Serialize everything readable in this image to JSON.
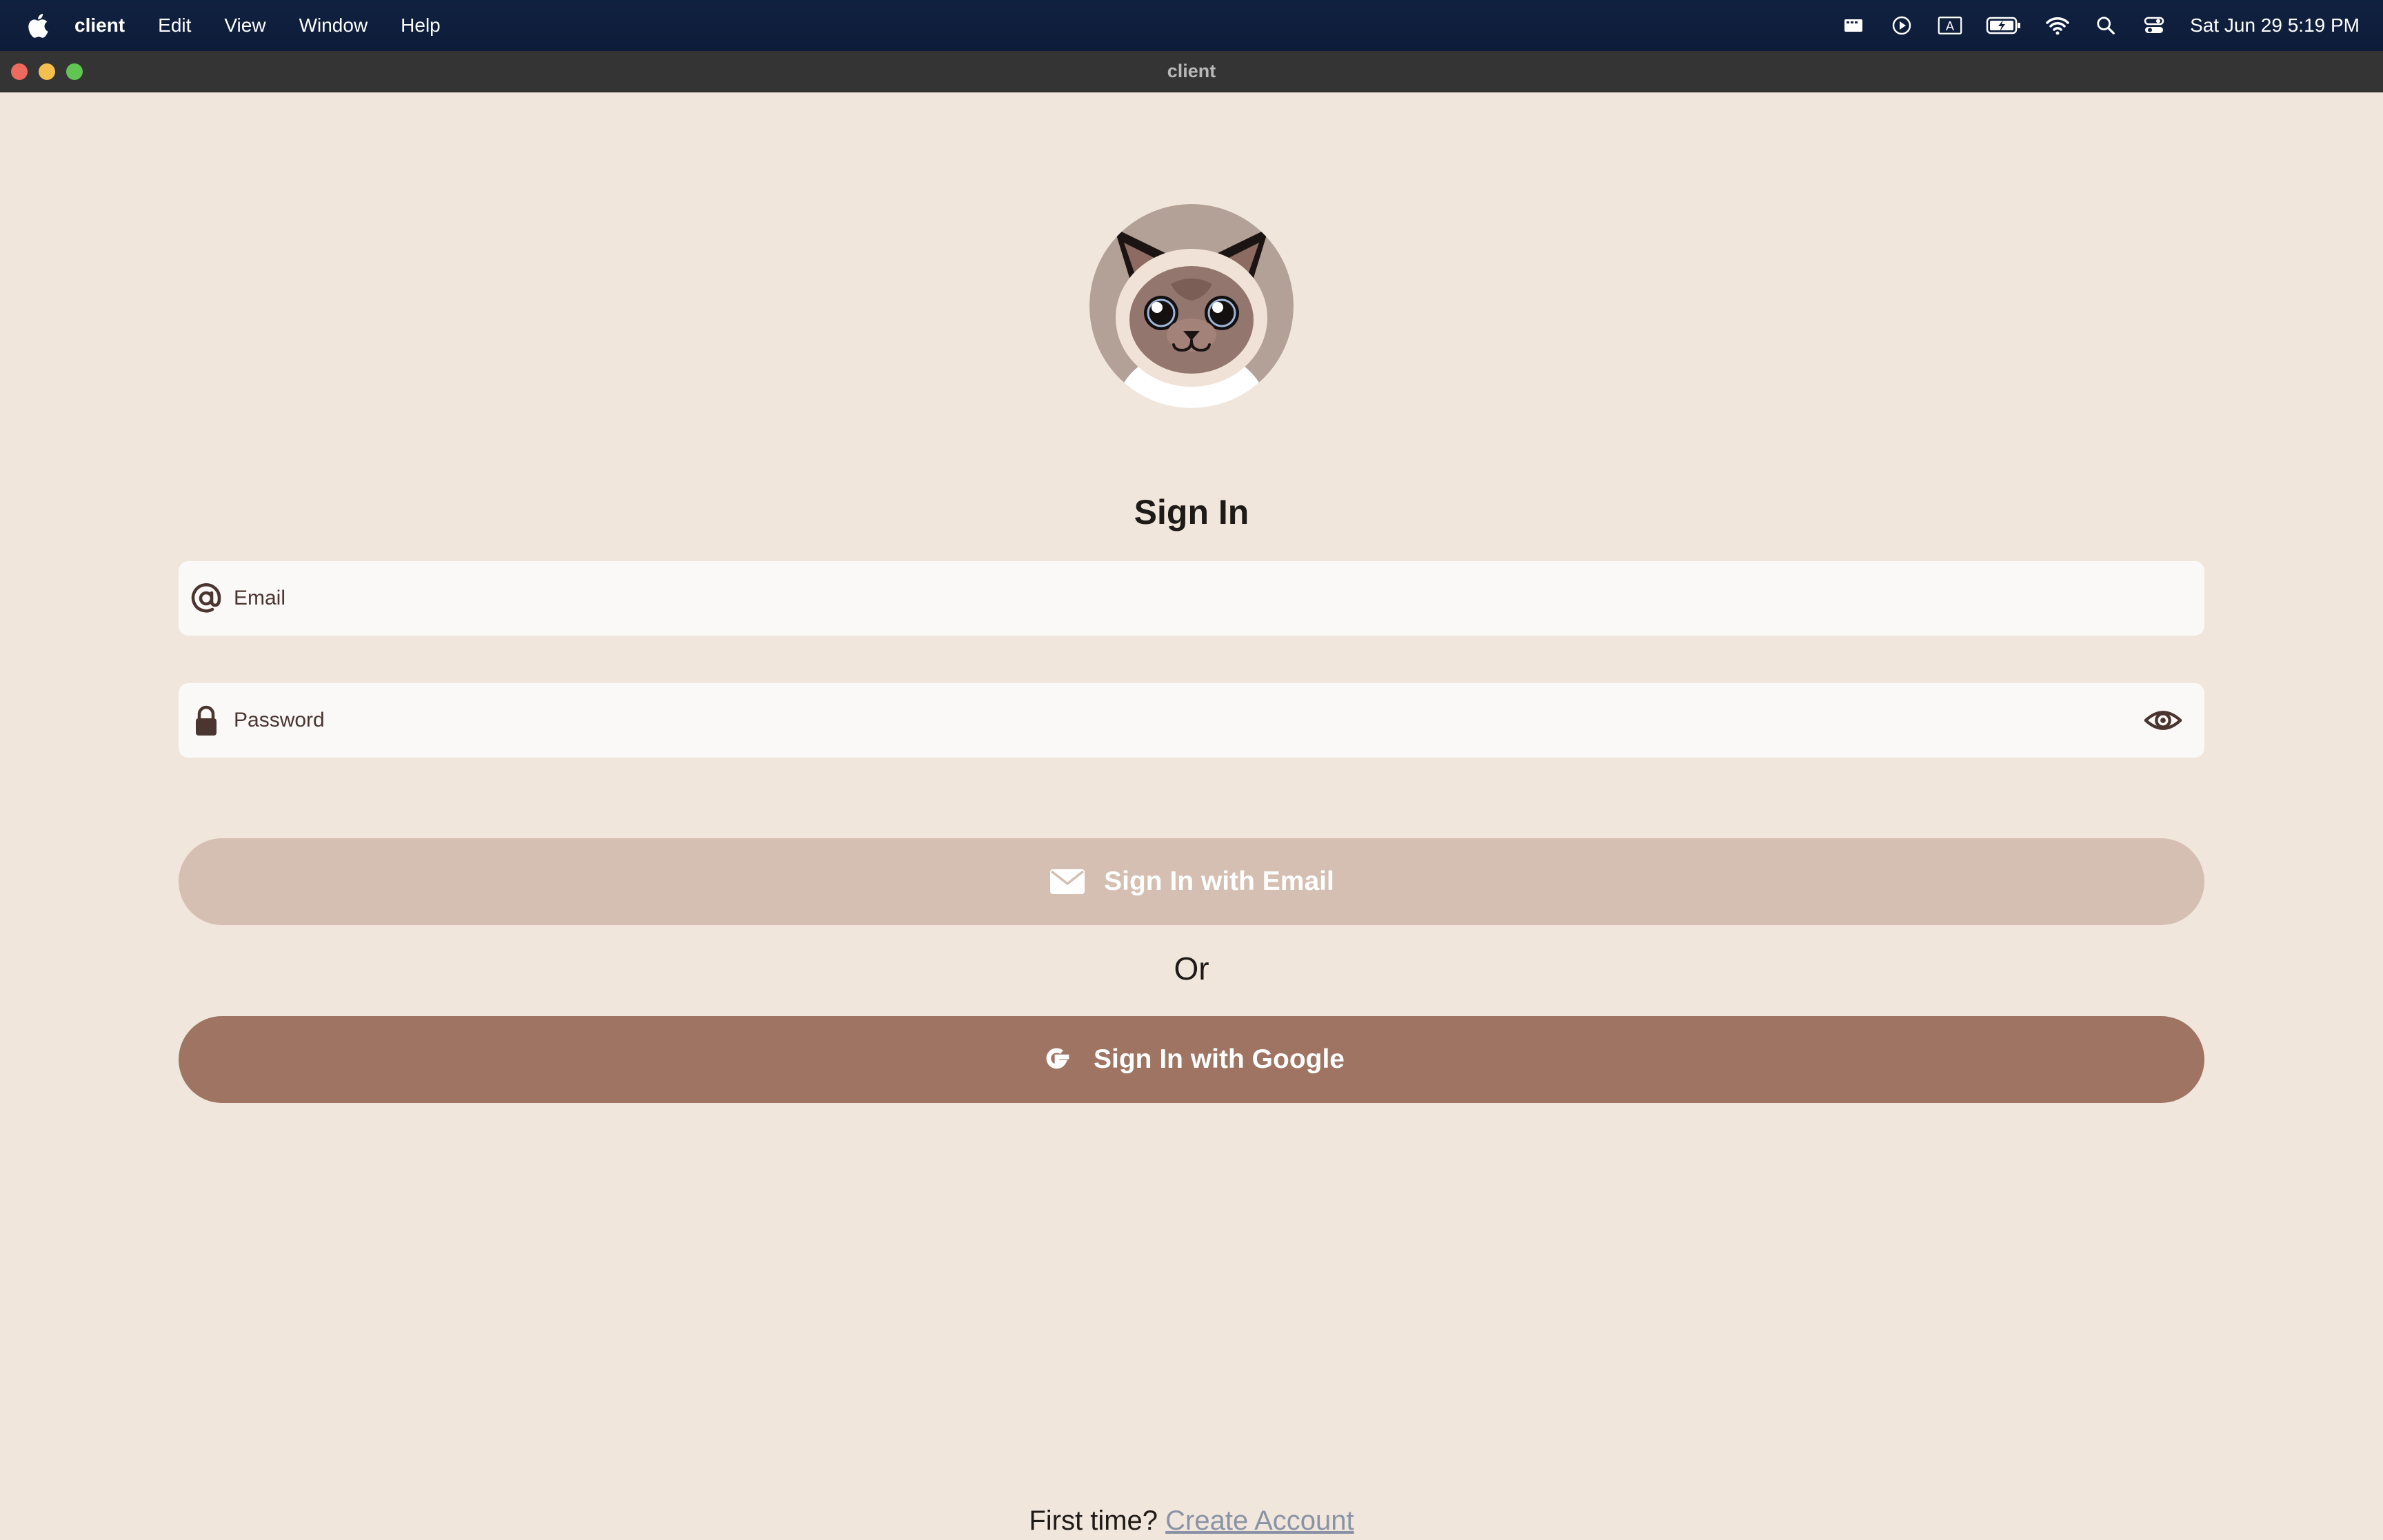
{
  "menubar": {
    "app_name": "client",
    "items": [
      "Edit",
      "View",
      "Window",
      "Help"
    ],
    "clock": "Sat Jun 29  5:19 PM",
    "status_icons": [
      "media-icon",
      "play-icon",
      "input-source-icon",
      "battery-icon",
      "wifi-icon",
      "spotlight-icon",
      "control-center-icon"
    ]
  },
  "window": {
    "title": "client"
  },
  "login": {
    "heading": "Sign In",
    "email_placeholder": "Email",
    "email_value": "",
    "password_placeholder": "Password",
    "password_value": "",
    "email_button": "Sign In with Email",
    "separator": "Or",
    "google_button": "Sign In with Google",
    "footer_prompt": "First time?",
    "footer_link": "Create Account"
  },
  "colors": {
    "background": "#f0e6db",
    "field_background": "#faf9f7",
    "email_button": "#d5bfb2",
    "google_button": "#9f7462",
    "link": "#8a93a6",
    "menubar": "#0f1f3d"
  }
}
